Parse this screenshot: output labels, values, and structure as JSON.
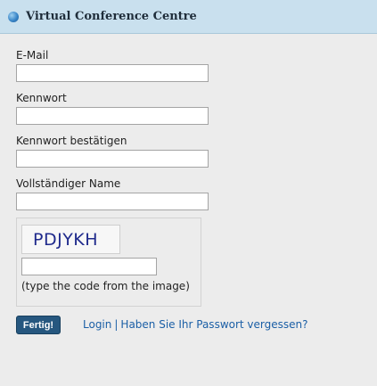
{
  "header": {
    "title": "Virtual Conference Centre",
    "icon": "globe-icon"
  },
  "form": {
    "email_label": "E-Mail",
    "password_label": "Kennwort",
    "confirm_label": "Kennwort bestätigen",
    "fullname_label": "Vollständiger Name",
    "email_value": "",
    "password_value": "",
    "confirm_value": "",
    "fullname_value": ""
  },
  "captcha": {
    "code": "PDJYKH",
    "input_value": "",
    "hint": "(type the code from the image)"
  },
  "actions": {
    "submit_label": "Fertig!",
    "login_label": "Login",
    "separator": "|",
    "forgot_label": "Haben Sie Ihr Passwort vergessen?"
  },
  "colors": {
    "header_bg": "#c9e0ee",
    "button_bg": "#26577f",
    "link": "#1b5fa6",
    "page_bg": "#ececec"
  }
}
